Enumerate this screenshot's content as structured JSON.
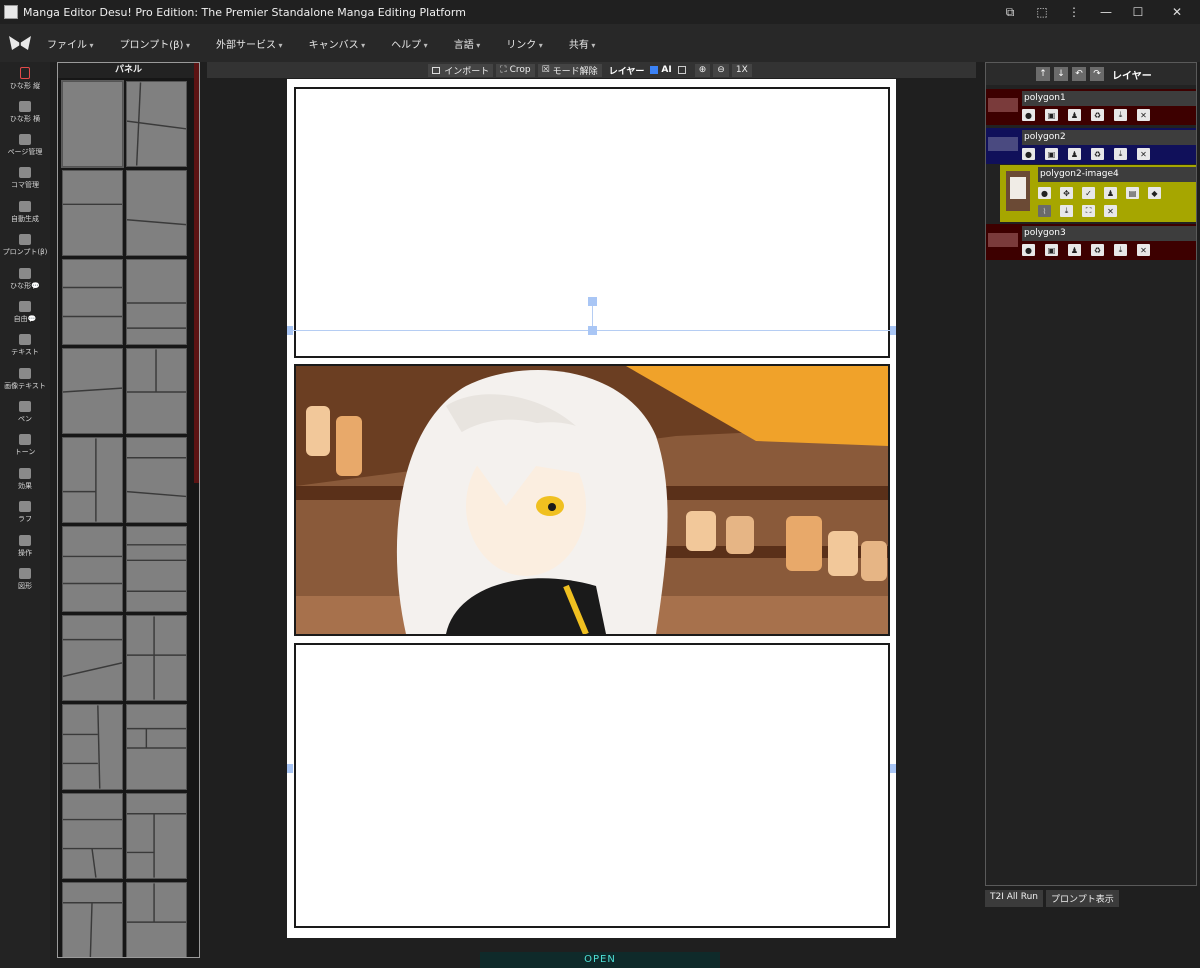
{
  "window": {
    "title": "Manga Editor Desu! Pro Edition: The Premier Standalone Manga Editing Platform",
    "controls": [
      "translate-icon",
      "extension-icon",
      "more-icon",
      "minimize",
      "maximize",
      "close"
    ]
  },
  "menu": [
    "ファイル",
    "プロンプト(β)",
    "外部サービス",
    "キャンバス",
    "ヘルプ",
    "言語",
    "リンク",
    "共有"
  ],
  "tools": [
    {
      "label": "ひな形 縦",
      "icon": "portrait-frame-icon",
      "active": true
    },
    {
      "label": "ひな形 横",
      "icon": "landscape-frame-icon"
    },
    {
      "label": "ページ管理",
      "icon": "page-grid-icon"
    },
    {
      "label": "コマ管理",
      "icon": "panel-grid-icon"
    },
    {
      "label": "自動生成",
      "icon": "robot-icon"
    },
    {
      "label": "プロンプト(β)",
      "icon": "clipboard-icon"
    },
    {
      "label": "ひな形💬",
      "icon": "speech-bubble-icon"
    },
    {
      "label": "自由💬",
      "icon": "free-bubble-icon"
    },
    {
      "label": "テキスト",
      "icon": "text-icon"
    },
    {
      "label": "画像テキスト",
      "icon": "image-text-icon"
    },
    {
      "label": "ペン",
      "icon": "pen-icon"
    },
    {
      "label": "トーン",
      "icon": "tone-icon"
    },
    {
      "label": "効果",
      "icon": "effect-icon"
    },
    {
      "label": "ラフ",
      "icon": "rough-icon"
    },
    {
      "label": "操作",
      "icon": "gamepad-icon"
    },
    {
      "label": "図形",
      "icon": "shapes-icon"
    }
  ],
  "panel": {
    "title": "パネル"
  },
  "toolbar": {
    "import": "インポート",
    "crop": "Crop",
    "mode_release": "モード解除",
    "layer_label": "レイヤー",
    "ai_label": "AI",
    "ai_checked": true,
    "second_checked": false,
    "zoom_reset": "1X"
  },
  "layers": {
    "title": "レイヤー",
    "items": [
      {
        "name": "polygon1",
        "bg": "#3d0000",
        "swatch": "#7a3b3b"
      },
      {
        "name": "polygon2",
        "bg": "#10105a",
        "swatch": "#4a4a80"
      },
      {
        "name": "polygon2-image4",
        "bg": "#a6a600",
        "child": true
      },
      {
        "name": "polygon3",
        "bg": "#3d0000",
        "swatch": "#7a3b3b"
      }
    ]
  },
  "bottom": {
    "t2i": "T2I All Run",
    "prompt": "プロンプト表示",
    "open": "OPEN"
  }
}
